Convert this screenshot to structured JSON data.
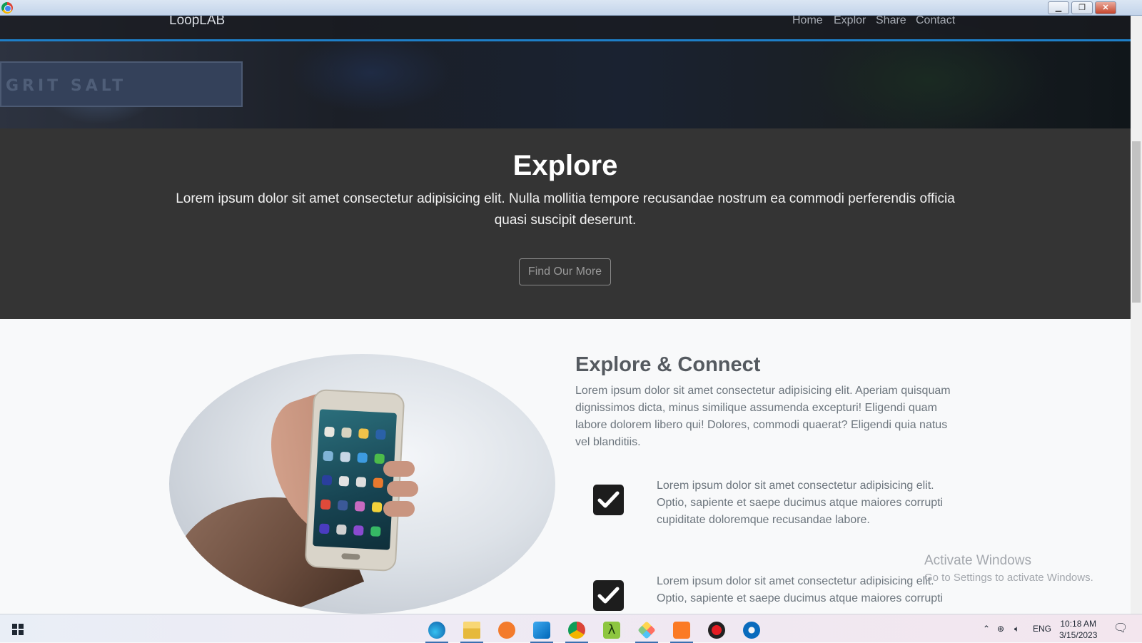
{
  "window": {
    "minimize_label": "▁",
    "restore_label": "❐",
    "close_label": "✕"
  },
  "navbar": {
    "brand": "LoopLAB",
    "links": [
      "Home",
      "Explor",
      "Share",
      "Contact"
    ]
  },
  "hero": {
    "sign_text": "GRIT SALT"
  },
  "explore": {
    "title": "Explore",
    "text": "Lorem ipsum dolor sit amet consectetur adipisicing elit. Nulla mollitia tempore recusandae nostrum ea commodi perferendis officia quasi suscipit deserunt.",
    "button_label": "Find Our More"
  },
  "connect": {
    "title": "Explore & Connect",
    "text": "Lorem ipsum dolor sit amet consectetur adipisicing elit. Aperiam quisquam dignissimos dicta, minus similique assumenda excepturi! Eligendi quam labore dolorem libero qui! Dolores, commodi quaerat? Eligendi quia natus vel blanditiis.",
    "features": [
      {
        "icon": "check-icon",
        "text": "Lorem ipsum dolor sit amet consectetur adipisicing elit. Optio, sapiente et saepe ducimus atque maiores corrupti cupiditate doloremque recusandae labore."
      },
      {
        "icon": "check-icon",
        "text": "Lorem ipsum dolor sit amet consectetur adipisicing elit. Optio, sapiente et saepe ducimus atque maiores corrupti"
      }
    ]
  },
  "watermark": {
    "title": "Activate Windows",
    "subtitle": "Go to Settings to activate Windows."
  },
  "taskbar": {
    "apps": [
      "edge-icon",
      "file-explorer-icon",
      "sublime-icon",
      "vscode-icon",
      "chrome-icon",
      "lambda-icon",
      "git-icon",
      "xampp-icon",
      "recorder-icon",
      "app-icon"
    ],
    "tray": {
      "language": "ENG",
      "time": "10:18 AM",
      "date": "3/15/2023"
    }
  },
  "colors": {
    "nav_accent": "#1e7fc8",
    "explore_bg": "#343434",
    "page_bg": "#f8f9fa",
    "text_muted": "#6c757d"
  }
}
